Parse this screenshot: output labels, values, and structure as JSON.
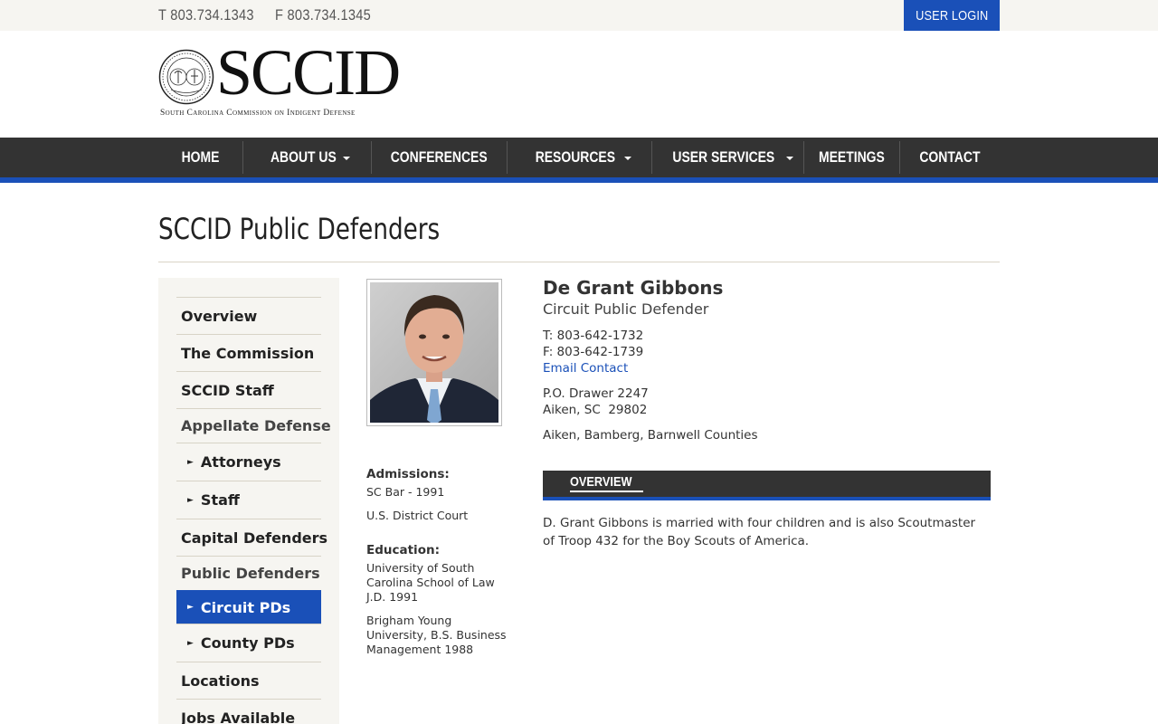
{
  "topbar": {
    "phone": "T 803.734.1343",
    "fax": "F 803.734.1345",
    "login_label": "USER LOGIN"
  },
  "logo": {
    "wordmark": "SCCID",
    "subtitle": "South Carolina Commission on Indigent Defense"
  },
  "nav": {
    "items": [
      {
        "label": "HOME",
        "dropdown": false
      },
      {
        "label": "ABOUT US",
        "dropdown": true
      },
      {
        "label": "CONFERENCES",
        "dropdown": false
      },
      {
        "label": "RESOURCES",
        "dropdown": true
      },
      {
        "label": "USER SERVICES",
        "dropdown": true
      },
      {
        "label": "MEETINGS",
        "dropdown": false
      },
      {
        "label": "CONTACT",
        "dropdown": false
      }
    ]
  },
  "page": {
    "title": "SCCID Public Defenders"
  },
  "sidebar": {
    "items": [
      {
        "label": "Overview"
      },
      {
        "label": "The Commission"
      },
      {
        "label": "SCCID Staff"
      },
      {
        "label": "Appellate Defense"
      },
      {
        "label": "Attorneys"
      },
      {
        "label": "Staff"
      },
      {
        "label": "Capital Defenders"
      },
      {
        "label": "Public Defenders"
      },
      {
        "label": "Circuit PDs"
      },
      {
        "label": "County PDs"
      },
      {
        "label": "Locations"
      },
      {
        "label": "Jobs Available"
      }
    ],
    "bullet": "►"
  },
  "profile": {
    "name": "De Grant Gibbons",
    "role": "Circuit Public Defender",
    "phone": "T: 803-642-1732",
    "fax": "F: 803-642-1739",
    "email_label": "Email Contact",
    "address_line1": "P.O. Drawer 2247",
    "address_line2": "Aiken, SC  29802",
    "counties": "Aiken, Bamberg, Barnwell Counties",
    "admissions_heading": "Admissions:",
    "admissions": [
      "SC Bar - 1991",
      "U.S. District Court"
    ],
    "education_heading": "Education:",
    "education": [
      "University of South Carolina School of Law J.D. 1991",
      "Brigham Young University, B.S. Business Management 1988"
    ],
    "overview_heading": "OVERVIEW",
    "overview_text": "D. Grant Gibbons is married with four children and is also Scoutmaster of Troop 432 for the Boy Scouts of America."
  },
  "colors": {
    "brand_blue": "#1a50b8",
    "nav_dark": "#333333",
    "sidebar_bg": "#f6f5f1"
  }
}
